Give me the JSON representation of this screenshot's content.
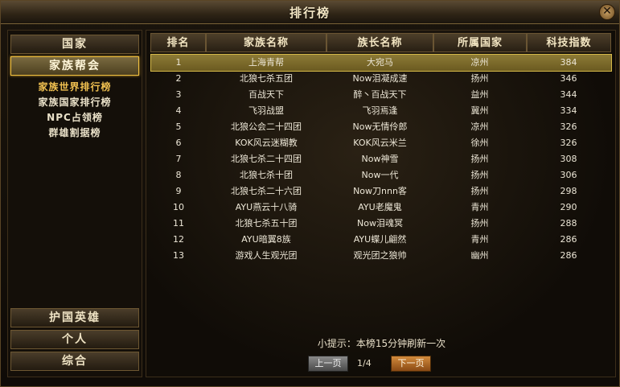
{
  "window": {
    "title": "排行榜",
    "close_label": "✕"
  },
  "sidebar": {
    "top_buttons": [
      {
        "label": "国家",
        "active": false
      },
      {
        "label": "家族帮会",
        "active": true
      }
    ],
    "sub_items": [
      {
        "label": "家族世界排行榜",
        "active": true
      },
      {
        "label": "家族国家排行榜",
        "active": false
      },
      {
        "label": "NPC占领榜",
        "active": false
      },
      {
        "label": "群雄割据榜",
        "active": false
      }
    ],
    "bottom_buttons": [
      {
        "label": "护国英雄"
      },
      {
        "label": "个人"
      },
      {
        "label": "综合"
      }
    ]
  },
  "table": {
    "columns": [
      "排名",
      "家族名称",
      "族长名称",
      "所属国家",
      "科技指数"
    ],
    "rows": [
      [
        "1",
        "上海青帮",
        "大宛马",
        "凉州",
        "384"
      ],
      [
        "2",
        "北狼七杀五团",
        "Now泪凝成速",
        "扬州",
        "346"
      ],
      [
        "3",
        "百战天下",
        "醉丶百战天下",
        "益州",
        "344"
      ],
      [
        "4",
        "飞羽战盟",
        "飞羽焉逢",
        "冀州",
        "334"
      ],
      [
        "5",
        "北狼公会二十四团",
        "Now无情伶郎",
        "凉州",
        "326"
      ],
      [
        "6",
        "KOK风云迷糊教",
        "KOK风云米兰",
        "徐州",
        "326"
      ],
      [
        "7",
        "北狼七杀二十四团",
        "Now神雪",
        "扬州",
        "308"
      ],
      [
        "8",
        "北狼七杀十团",
        "Now一代",
        "扬州",
        "306"
      ],
      [
        "9",
        "北狼七杀二十六团",
        "Now刀nnn客",
        "扬州",
        "298"
      ],
      [
        "10",
        "AYU燕云十八骑",
        "AYU老魔鬼",
        "青州",
        "290"
      ],
      [
        "11",
        "北狼七杀五十团",
        "Now泪魂冥",
        "扬州",
        "288"
      ],
      [
        "12",
        "AYU暗翼8族",
        "AYU蝶儿翩然",
        "青州",
        "286"
      ],
      [
        "13",
        "游戏人生观光团",
        "观光团之狼帅",
        "幽州",
        "286"
      ]
    ],
    "selected_row": 0
  },
  "footer": {
    "tip": "小提示：本榜15分钟刷新一次",
    "prev_label": "上一页",
    "next_label": "下一页",
    "page_info": "1/4"
  }
}
